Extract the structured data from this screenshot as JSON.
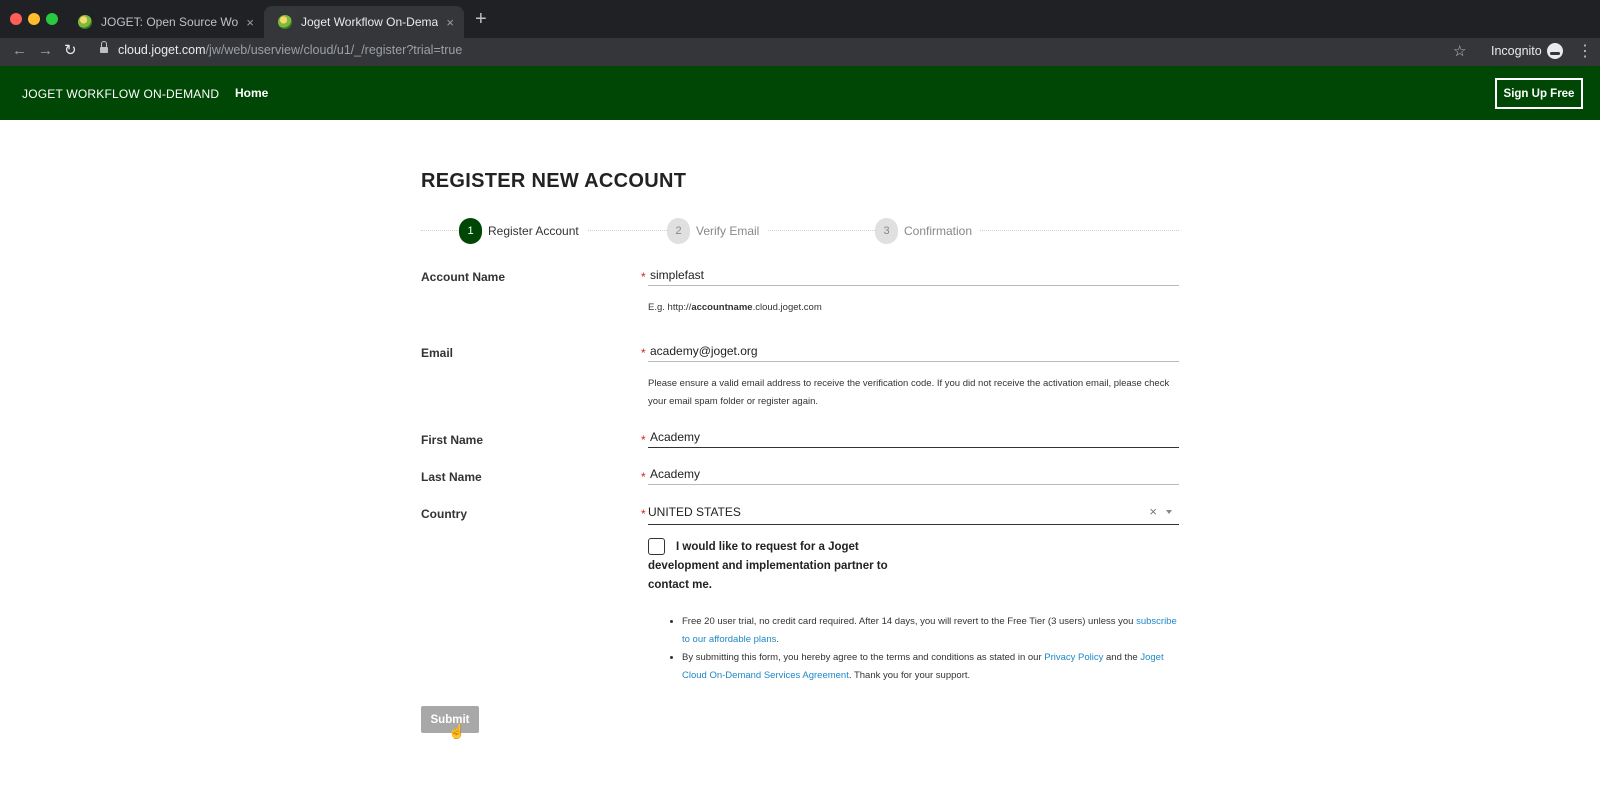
{
  "browser": {
    "tabs": [
      {
        "title": "JOGET: Open Source Workflow",
        "active": false
      },
      {
        "title": "Joget Workflow On-Demand >",
        "active": true
      }
    ],
    "close_glyph": "×",
    "new_tab_glyph": "+",
    "url_host": "cloud.joget.com",
    "url_path": "/jw/web/userview/cloud/u1/_/register?trial=true",
    "incognito_label": "Incognito"
  },
  "header": {
    "brand": "JOGET WORKFLOW ON-DEMAND",
    "home": "Home",
    "signup": "Sign Up Free",
    "background": "#004705"
  },
  "form": {
    "title": "REGISTER NEW ACCOUNT",
    "steps": [
      {
        "number": "1",
        "label": "Register Account",
        "state": "active"
      },
      {
        "number": "2",
        "label": "Verify Email",
        "state": "inactive"
      },
      {
        "number": "3",
        "label": "Confirmation",
        "state": "inactive"
      }
    ],
    "required_mark": "*",
    "account_name": {
      "label": "Account Name",
      "value": "simplefast",
      "hint_prefix": "E.g. http://",
      "hint_bold": "accountname",
      "hint_suffix": ".cloud.joget.com"
    },
    "email": {
      "label": "Email",
      "value": "academy@joget.org",
      "hint": "Please ensure a valid email address to receive the verification code. If you did not receive the activation email, please check your email spam folder or register again."
    },
    "first_name": {
      "label": "First Name",
      "value": "Academy"
    },
    "last_name": {
      "label": "Last Name",
      "value": "Academy"
    },
    "country": {
      "label": "Country",
      "value": "UNITED STATES",
      "clear_glyph": "×"
    },
    "partner_request": {
      "label": "I would like to request for a Joget development and implementation partner to contact me.",
      "checked": false
    },
    "notes": {
      "trial_text": "Free 20 user trial, no credit card required. After 14 days, you will revert to the Free Tier (3 users) unless you ",
      "trial_link": "subscribe to our affordable plans",
      "trial_end": ".",
      "terms_text": "By submitting this form, you hereby agree to the terms and conditions as stated in our ",
      "privacy_link": "Privacy Policy",
      "terms_and": " and the ",
      "agreement_link": "Joget Cloud On-Demand Services Agreement",
      "terms_end": ". Thank you for your support."
    },
    "submit": "Submit"
  }
}
